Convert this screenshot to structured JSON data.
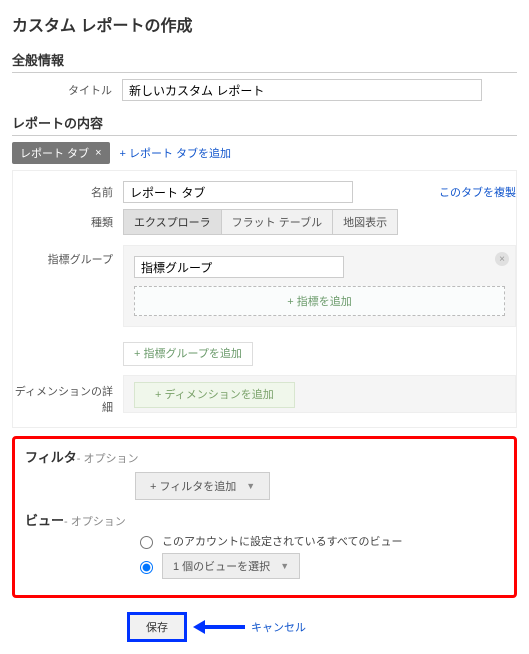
{
  "page_title": "カスタム レポートの作成",
  "general": {
    "heading": "全般情報",
    "title_label": "タイトル",
    "title_value": "新しいカスタム レポート"
  },
  "content": {
    "heading": "レポートの内容",
    "tab_chip": "レポート タブ",
    "add_tab": "+ レポート タブを追加",
    "name_label": "名前",
    "name_value": "レポート タブ",
    "duplicate": "このタブを複製",
    "type_label": "種類",
    "types": {
      "explorer": "エクスプローラ",
      "flat": "フラット テーブル",
      "map": "地図表示"
    },
    "metric_group_label": "指標グループ",
    "metric_group_value": "指標グループ",
    "add_metric": "+ 指標を追加",
    "add_metric_group": "+ 指標グループを追加",
    "dimension_label": "ディメンションの詳細",
    "add_dimension": "+ ディメンションを追加"
  },
  "filter": {
    "heading": "フィルタ",
    "optional": "- オプション",
    "add_filter": "+ フィルタを追加"
  },
  "view": {
    "heading": "ビュー",
    "optional": "- オプション",
    "opt_all": "このアカウントに設定されているすべてのビュー",
    "opt_one": "1 個のビューを選択"
  },
  "footer": {
    "save": "保存",
    "cancel": "キャンセル"
  }
}
